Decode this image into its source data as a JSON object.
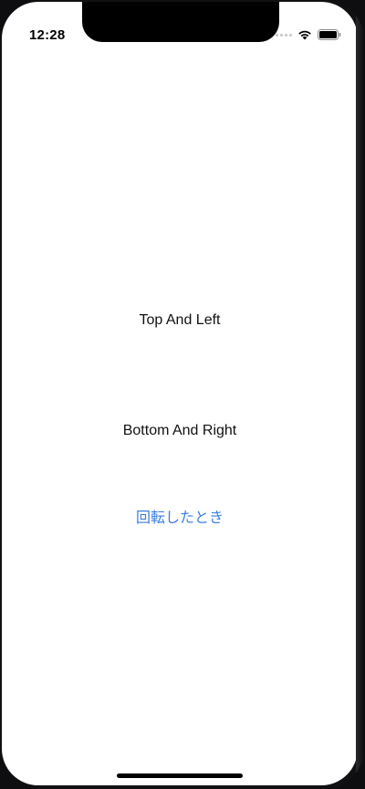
{
  "status_bar": {
    "time": "12:28",
    "icons": [
      "cellular-signal-icon",
      "wifi-icon",
      "battery-icon"
    ]
  },
  "content": {
    "top_left_label": "Top And Left",
    "bottom_right_label": "Bottom And Right",
    "rotate_button_label": "回転したとき"
  },
  "colors": {
    "accent": "#3a7fe0",
    "text": "#111111",
    "background": "#ffffff"
  }
}
